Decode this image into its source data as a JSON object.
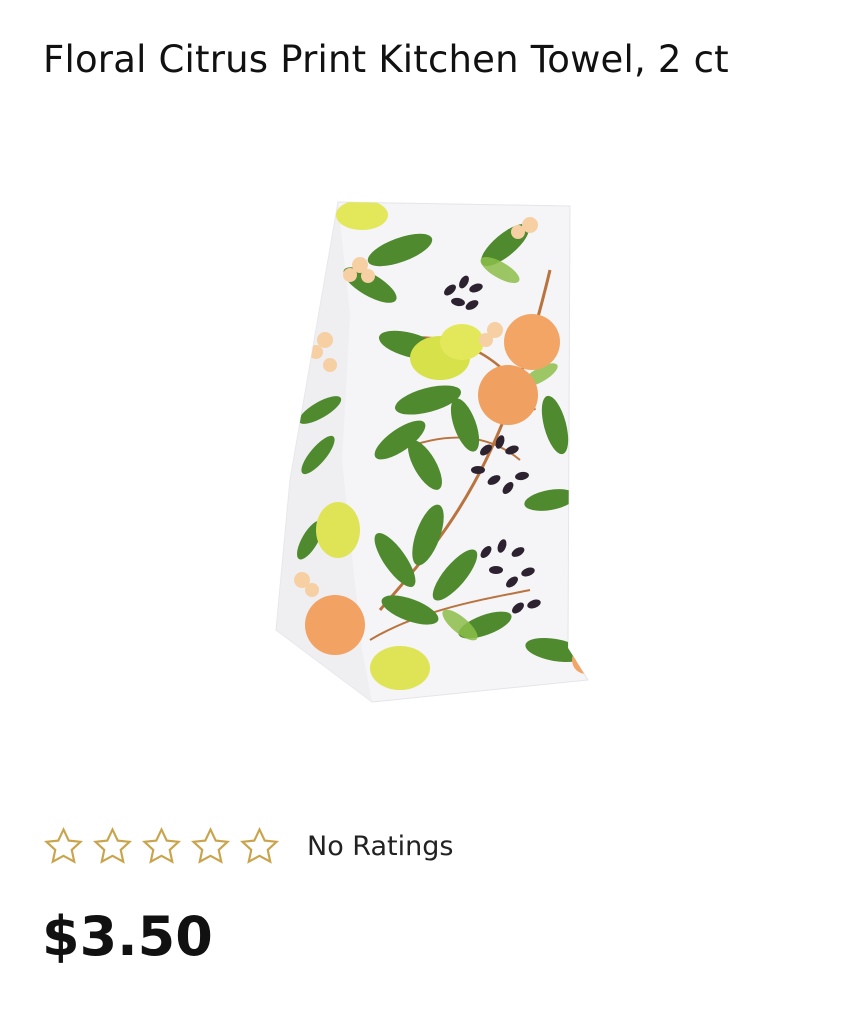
{
  "product": {
    "title": "Floral Citrus Print Kitchen Towel, 2 ct",
    "image_icon": "floral-citrus-towel-image",
    "price": "$3.50",
    "rating": {
      "stars_total": 5,
      "stars_filled": 0,
      "text": "No Ratings",
      "star_color": "#c9a44c"
    }
  }
}
